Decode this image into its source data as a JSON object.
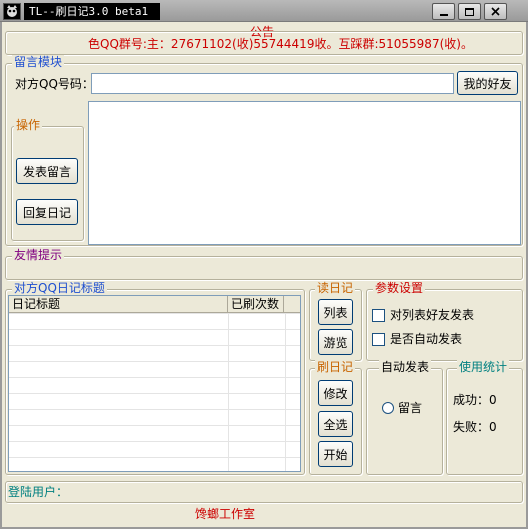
{
  "window": {
    "title": "TL--刷日记3.0 beta1"
  },
  "notice": {
    "label": "公告",
    "text": "色QQ群号:主：27671102(收)55744419收。互踩群:51055987(收)。"
  },
  "message_module": {
    "legend": "留言模块",
    "qq_label": "对方QQ号码：",
    "qq_value": "",
    "my_friends_button": "我的好友",
    "operations_legend": "操作",
    "post_message_button": "发表留言",
    "reply_diary_button": "回复日记",
    "message_text": ""
  },
  "tips": {
    "legend": "友情提示",
    "text": ""
  },
  "diary_list": {
    "legend": "对方QQ日记标题",
    "columns": [
      "日记标题",
      "已刷次数"
    ],
    "rows": []
  },
  "read_diary": {
    "legend": "读日记",
    "list_button": "列表",
    "browse_button": "游览"
  },
  "settings": {
    "legend": "参数设置",
    "option_friends": "对列表好友发表",
    "option_auto": "是否自动发表"
  },
  "brush_diary": {
    "legend": "刷日记",
    "edit_button": "修改",
    "select_all_button": "全选",
    "start_button": "开始"
  },
  "auto_post": {
    "legend": "自动发表",
    "radio_label": "留言"
  },
  "stats": {
    "legend": "使用统计",
    "success_label": "成功：",
    "success_value": "0",
    "fail_label": "失败：",
    "fail_value": "0"
  },
  "status": {
    "login_label": "登陆用户：",
    "login_value": "",
    "footer": "馋螂工作室"
  },
  "colors": {
    "red": "#cc0000",
    "blue": "#1f4fd0",
    "purple": "#800080",
    "teal": "#008080",
    "orange": "#c86400"
  }
}
